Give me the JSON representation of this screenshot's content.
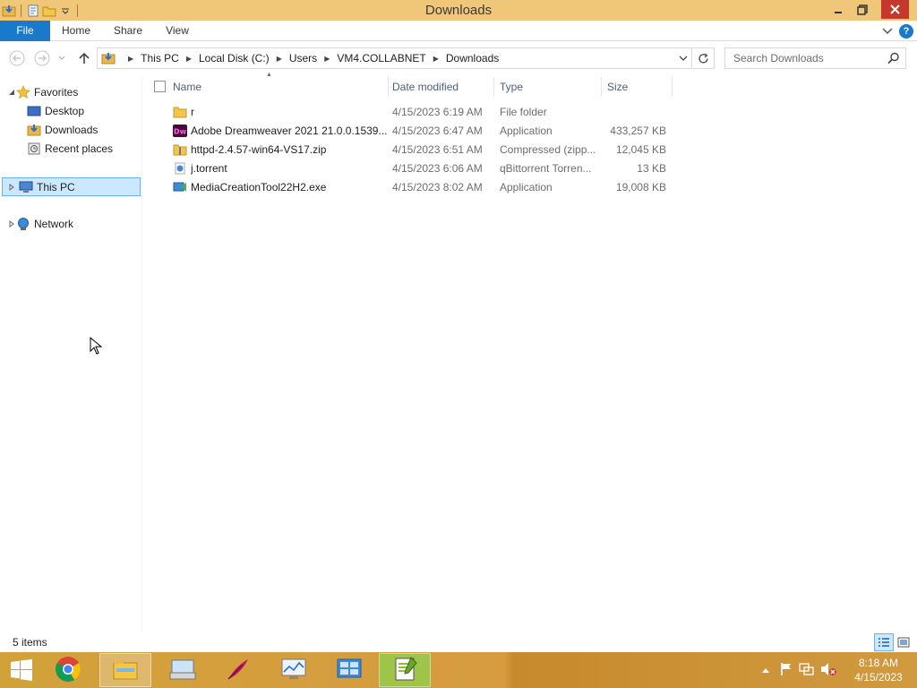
{
  "window": {
    "title": "Downloads"
  },
  "ribbon": {
    "tabs": [
      "File",
      "Home",
      "Share",
      "View"
    ]
  },
  "address": {
    "segments": [
      "This PC",
      "Local Disk (C:)",
      "Users",
      "VM4.COLLABNET",
      "Downloads"
    ]
  },
  "search": {
    "placeholder": "Search Downloads"
  },
  "navpane": {
    "favorites": "Favorites",
    "desktop": "Desktop",
    "downloads": "Downloads",
    "recent": "Recent places",
    "thispc": "This PC",
    "network": "Network"
  },
  "columns": {
    "name": "Name",
    "date": "Date modified",
    "type": "Type",
    "size": "Size"
  },
  "files": [
    {
      "name": "r",
      "date": "4/15/2023 6:19 AM",
      "type": "File folder",
      "size": "",
      "icon": "folder-icon"
    },
    {
      "name": "Adobe Dreamweaver 2021 21.0.0.1539...",
      "date": "4/15/2023 6:47 AM",
      "type": "Application",
      "size": "433,257 KB",
      "icon": "dreamweaver-icon"
    },
    {
      "name": "httpd-2.4.57-win64-VS17.zip",
      "date": "4/15/2023 6:51 AM",
      "type": "Compressed (zipp...",
      "size": "12,045 KB",
      "icon": "zip-icon"
    },
    {
      "name": "j.torrent",
      "date": "4/15/2023 6:06 AM",
      "type": "qBittorrent Torren...",
      "size": "13 KB",
      "icon": "torrent-icon"
    },
    {
      "name": "MediaCreationTool22H2.exe",
      "date": "4/15/2023 8:02 AM",
      "type": "Application",
      "size": "19,008 KB",
      "icon": "media-creation-icon"
    }
  ],
  "status": {
    "count": "5 items"
  },
  "clock": {
    "time": "8:18 AM",
    "date": "4/15/2023"
  },
  "colors": {
    "titlebar": "#f0c779",
    "accent": "#1979ca",
    "close": "#c5392c",
    "selection": "#cce8ff"
  }
}
